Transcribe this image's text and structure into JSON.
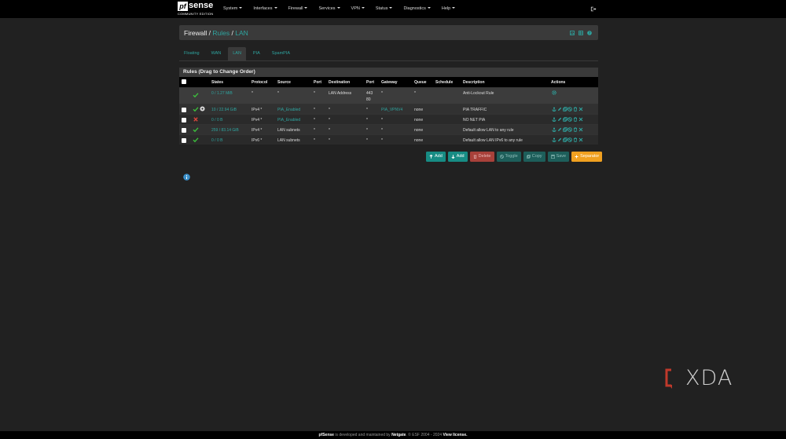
{
  "brand": {
    "logo_box": "pf",
    "logo_word": "sense",
    "edition": "COMMUNITY EDITION"
  },
  "nav": {
    "items": [
      "System",
      "Interfaces",
      "Firewall",
      "Services",
      "VPN",
      "Status",
      "Diagnostics",
      "Help"
    ]
  },
  "breadcrumb": {
    "root": "Firewall",
    "sep": "/",
    "rules": "Rules",
    "current": "LAN"
  },
  "tabs": [
    "Floating",
    "WAN",
    "LAN",
    "PIA",
    "SpamPIA"
  ],
  "active_tab": "LAN",
  "panel": {
    "title": "Rules (Drag to Change Order)"
  },
  "table": {
    "headers": [
      "States",
      "Protocol",
      "Source",
      "Port",
      "Destination",
      "Port",
      "Gateway",
      "Queue",
      "Schedule",
      "Description",
      "Actions"
    ],
    "rows": [
      {
        "states": "0 / 1.27 MiB",
        "protocol": "*",
        "source": "*",
        "port": "*",
        "destination": "LAN Address",
        "dport": "443",
        "dport2": "80",
        "gateway": "*",
        "queue": "*",
        "schedule": "",
        "description": "Anti-Lockout Rule",
        "status": "pass"
      },
      {
        "states": "10 / 22.94 GiB",
        "protocol": "IPv4 *",
        "source": "PIA_Enabled",
        "port": "*",
        "destination": "*",
        "dport": "*",
        "gateway": "PIA_VPNV4",
        "queue": "none",
        "schedule": "",
        "description": "PIA TRAFFIC",
        "status": "pass-adv"
      },
      {
        "states": "0 / 0 B",
        "protocol": "IPv4 *",
        "source": "PIA_Enabled",
        "port": "*",
        "destination": "*",
        "dport": "*",
        "gateway": "*",
        "queue": "none",
        "schedule": "",
        "description": "NO NET PIA",
        "status": "block"
      },
      {
        "states": "259 / 83.14 GiB",
        "protocol": "IPv4 *",
        "source": "LAN subnets",
        "port": "*",
        "destination": "*",
        "dport": "*",
        "gateway": "*",
        "queue": "none",
        "schedule": "",
        "description": "Default allow LAN to any rule",
        "status": "pass"
      },
      {
        "states": "0 / 0 B",
        "protocol": "IPv6 *",
        "source": "LAN subnets",
        "port": "*",
        "destination": "*",
        "dport": "*",
        "gateway": "*",
        "queue": "none",
        "schedule": "",
        "description": "Default allow LAN IPv6 to any rule",
        "status": "pass"
      }
    ]
  },
  "buttons": {
    "add_top": "Add",
    "add_bottom": "Add",
    "delete": "Delete",
    "toggle": "Toggle",
    "copy": "Copy",
    "save": "Save",
    "separator": "Separator"
  },
  "footer": {
    "product": "pfSense",
    "mid": " is developed and maintained by ",
    "company": "Netgate",
    "copy": ". © ESF 2004 - 2024 ",
    "license": "View license."
  },
  "watermark": "XDA",
  "colors": {
    "accent": "#2ea5a0",
    "pass": "#3cbf3c",
    "block": "#d9453b",
    "orange": "#f0a020"
  }
}
